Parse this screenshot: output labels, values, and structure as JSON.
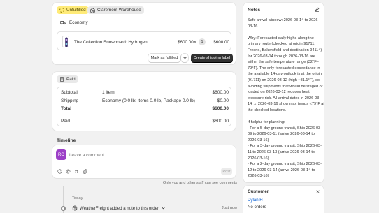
{
  "fulfillment": {
    "status_badge": "Unfulfilled",
    "location_badge": "Claremont Warehouse",
    "shipping_method": "Economy",
    "product_name": "The Collection Snowboard: Hydrogen",
    "unit_price": "$600.00",
    "times": "×",
    "quantity": "1",
    "line_total": "$600.00",
    "mark_fulfilled_label": "Mark as fulfilled",
    "create_label_label": "Create shipping label"
  },
  "payment": {
    "status_badge": "Paid",
    "rows": [
      {
        "label": "Subtotal",
        "detail": "1 item",
        "amount": "$600.00"
      },
      {
        "label": "Shipping",
        "detail": "Economy (0.0 lb: Items 0.0 lb, Package 0.0 lb)",
        "amount": "$0.00"
      },
      {
        "label": "Total",
        "detail": "",
        "amount": "$600.00"
      }
    ],
    "paid_label": "Paid",
    "paid_amount": "$600.00"
  },
  "timeline": {
    "title": "Timeline",
    "avatar_initials": "RO",
    "comment_placeholder": "Leave a comment...",
    "post_label": "Post",
    "visibility_note": "Only you and other staff can see comments",
    "date_heading": "Today",
    "event_text": "WeatherFreight added a note to this order.",
    "event_time": "Just now"
  },
  "notes": {
    "title": "Notes",
    "lines": [
      "Safe arrival window: 2026-03-14 to 2026-03-16",
      "",
      "Why: Forecasted daily highs along the primary route (checked at origin 91711, Fresno, Bakersfield and destination 94114) for 2026-03-14 through 2026-03-16 are within the safe temperature range (32°F–79°F). The only forecasted exceedance in the available 14-day outlook is at the origin (91711) on 2026-03-12 (high ~81.1°F), so avoiding shipments that would be staged or loaded on 2026-03-12 reduces heat exposure risk. All arrival dates in 2026-03-14 → 2026-03-16 show max temps <79°F at the checked locations.",
      "",
      "If helpful for planning:",
      "- For a 5-day ground transit, Ship 2026-03-09 to 2026-03-11 (arrive 2026-03-14 to 2026-03-16)",
      "- For a 3-day ground transit, Ship 2026-03-11 to 2026-03-13 (arrive 2026-03-14 to 2026-03-16)",
      "- For a 2-day ground transit, Ship 2026-03-12 to 2026-03-14 (arrive 2026-03-14 to 2026-03-16)"
    ]
  },
  "customer": {
    "title": "Customer",
    "name": "Dylan H",
    "orders": "No orders"
  },
  "colors": {
    "background": "#f1f1f1",
    "unfulfilled_badge": "#ffeb78",
    "primary_button": "#303030",
    "avatar": "#9c3fc7",
    "link": "#005bd3"
  }
}
